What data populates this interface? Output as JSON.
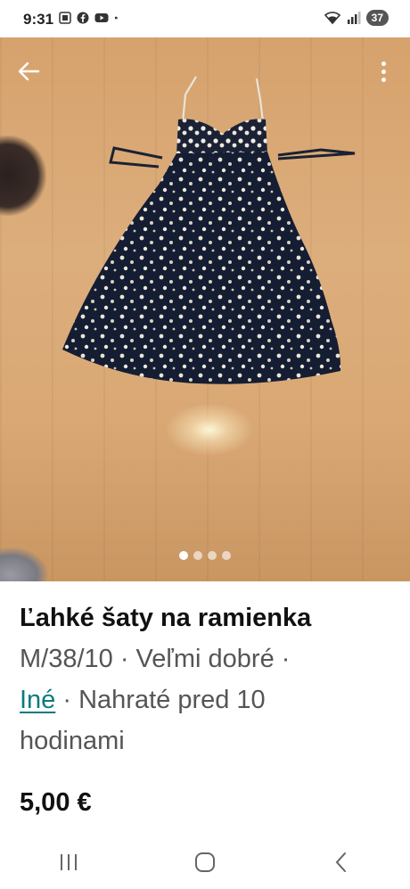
{
  "status_bar": {
    "time": "9:31",
    "battery": "37",
    "icons": [
      "screenshot-icon",
      "facebook-icon",
      "youtube-icon",
      "dot-icon",
      "wifi-icon",
      "signal-icon"
    ]
  },
  "photo": {
    "page_indicator": {
      "count": 4,
      "active": 1
    }
  },
  "listing": {
    "title": "Ľahké šaty na ramienka",
    "meta_1": "M/38/10 · Veľmi dobré ·",
    "brand_link": "Iné",
    "meta_2": " · Nahraté pred 10",
    "meta_3": "hodinami",
    "price": "5,00 €"
  },
  "colors": {
    "link": "#0a7a7f",
    "text": "#111111",
    "secondary_text": "#555555"
  }
}
